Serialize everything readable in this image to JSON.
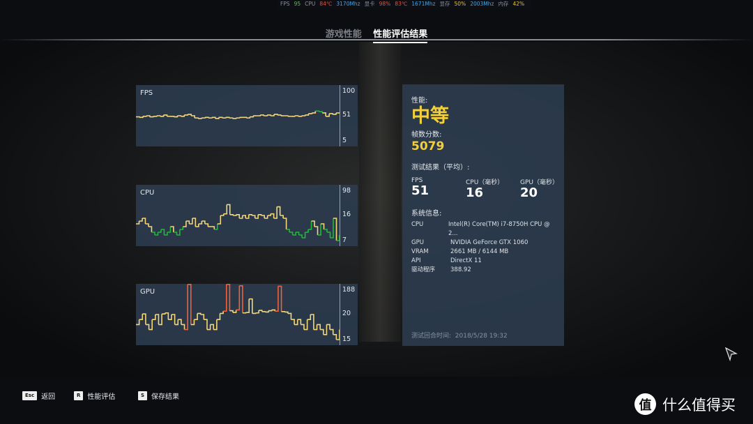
{
  "osd": [
    {
      "t": "FPS",
      "c": "#8a93a0"
    },
    {
      "t": "95",
      "c": "#5fc24a"
    },
    {
      "t": "CPU",
      "c": "#8a93a0"
    },
    {
      "t": "84℃",
      "c": "#e0533d"
    },
    {
      "t": "3170Mhz",
      "c": "#4aa3e0"
    },
    {
      "t": "显卡",
      "c": "#8a93a0"
    },
    {
      "t": "98%",
      "c": "#e0533d"
    },
    {
      "t": "83℃",
      "c": "#e0533d"
    },
    {
      "t": "1671Mhz",
      "c": "#4aa3e0"
    },
    {
      "t": "显存",
      "c": "#8a93a0"
    },
    {
      "t": "50%",
      "c": "#e0c23d"
    },
    {
      "t": "2003Mhz",
      "c": "#4aa3e0"
    },
    {
      "t": "内存",
      "c": "#8a93a0"
    },
    {
      "t": "42%",
      "c": "#e0c23d"
    }
  ],
  "tabs": [
    {
      "label": "游戏性能",
      "active": false
    },
    {
      "label": "性能评估结果",
      "active": true
    }
  ],
  "colors": {
    "normal": "#f5d77a",
    "good": "#22b83a",
    "spike": "#f0623a",
    "accent": "#f3cf3a"
  },
  "chart_data": [
    {
      "type": "line",
      "title": "FPS",
      "max": 100,
      "avg": 51,
      "min": 5,
      "good_above": 56,
      "values": [
        49,
        48,
        50,
        51,
        49,
        50,
        51,
        50,
        52,
        50,
        50,
        49,
        51,
        50,
        52,
        53,
        51,
        47,
        46,
        47,
        48,
        47,
        48,
        46,
        48,
        47,
        48,
        47,
        46,
        47,
        48,
        48,
        47,
        49,
        51,
        51,
        52,
        51,
        52,
        51,
        53,
        52,
        51,
        51,
        50,
        50,
        51,
        50,
        51,
        52,
        54,
        55,
        58,
        57,
        55,
        50,
        54,
        53,
        55,
        55
      ]
    },
    {
      "type": "line",
      "title": "CPU",
      "max": 98,
      "avg": 16,
      "min": 7,
      "good_below": 12,
      "values": [
        13,
        14,
        15,
        13,
        12,
        10,
        9,
        10,
        11,
        9,
        10,
        12,
        10,
        9,
        11,
        12,
        14,
        13,
        15,
        12,
        13,
        14,
        13,
        12,
        12,
        11,
        13,
        16,
        18,
        35,
        17,
        16,
        17,
        15,
        16,
        15,
        17,
        16,
        15,
        17,
        16,
        15,
        16,
        18,
        15,
        30,
        16,
        15,
        11,
        10,
        9,
        10,
        9,
        8,
        10,
        11,
        14,
        12,
        9,
        13,
        11,
        10,
        8,
        15,
        7,
        9
      ]
    },
    {
      "type": "line",
      "title": "GPU",
      "max": 188,
      "avg": 20,
      "min": 15,
      "spike_above": 188,
      "values": [
        18,
        19,
        21,
        18,
        17,
        19,
        20,
        18,
        21,
        23,
        19,
        20,
        18,
        19,
        18,
        17,
        300,
        18,
        19,
        22,
        20,
        19,
        17,
        18,
        17,
        19,
        22,
        27,
        300,
        28,
        24,
        30,
        260,
        23,
        24,
        80,
        22,
        23,
        29,
        26,
        25,
        28,
        30,
        27,
        250,
        26,
        25,
        22,
        19,
        18,
        19,
        18,
        17,
        19,
        20,
        17,
        18,
        17,
        16,
        18,
        17,
        16,
        15,
        17
      ]
    }
  ],
  "info": {
    "perf_label": "性能:",
    "perf_value": "中等",
    "score_label": "帧数分数:",
    "score_value": "5079",
    "avg_label": "测试结果（平均）:",
    "avg": [
      {
        "k": "FPS",
        "v": "51"
      },
      {
        "k": "CPU（毫秒）",
        "v": "16"
      },
      {
        "k": "GPU（毫秒）",
        "v": "20"
      }
    ],
    "sys_label": "系统信息:",
    "sys": [
      {
        "k": "CPU",
        "v": "Intel(R) Core(TM) i7-8750H CPU @ 2..."
      },
      {
        "k": "GPU",
        "v": "NVIDIA GeForce GTX 1060"
      },
      {
        "k": "VRAM",
        "v": "2661 MB / 6144 MB"
      },
      {
        "k": "API",
        "v": "DirectX 11"
      },
      {
        "k": "驱动程序",
        "v": "388.92"
      }
    ],
    "time_label": "测试回合时间:",
    "time_value": "2018/5/28 19:32"
  },
  "footer": [
    {
      "key": "Esc",
      "label": "返回"
    },
    {
      "key": "R",
      "label": "性能评估"
    },
    {
      "key": "S",
      "label": "保存结果"
    }
  ],
  "watermark": {
    "glyph": "值",
    "text": "什么值得买"
  }
}
